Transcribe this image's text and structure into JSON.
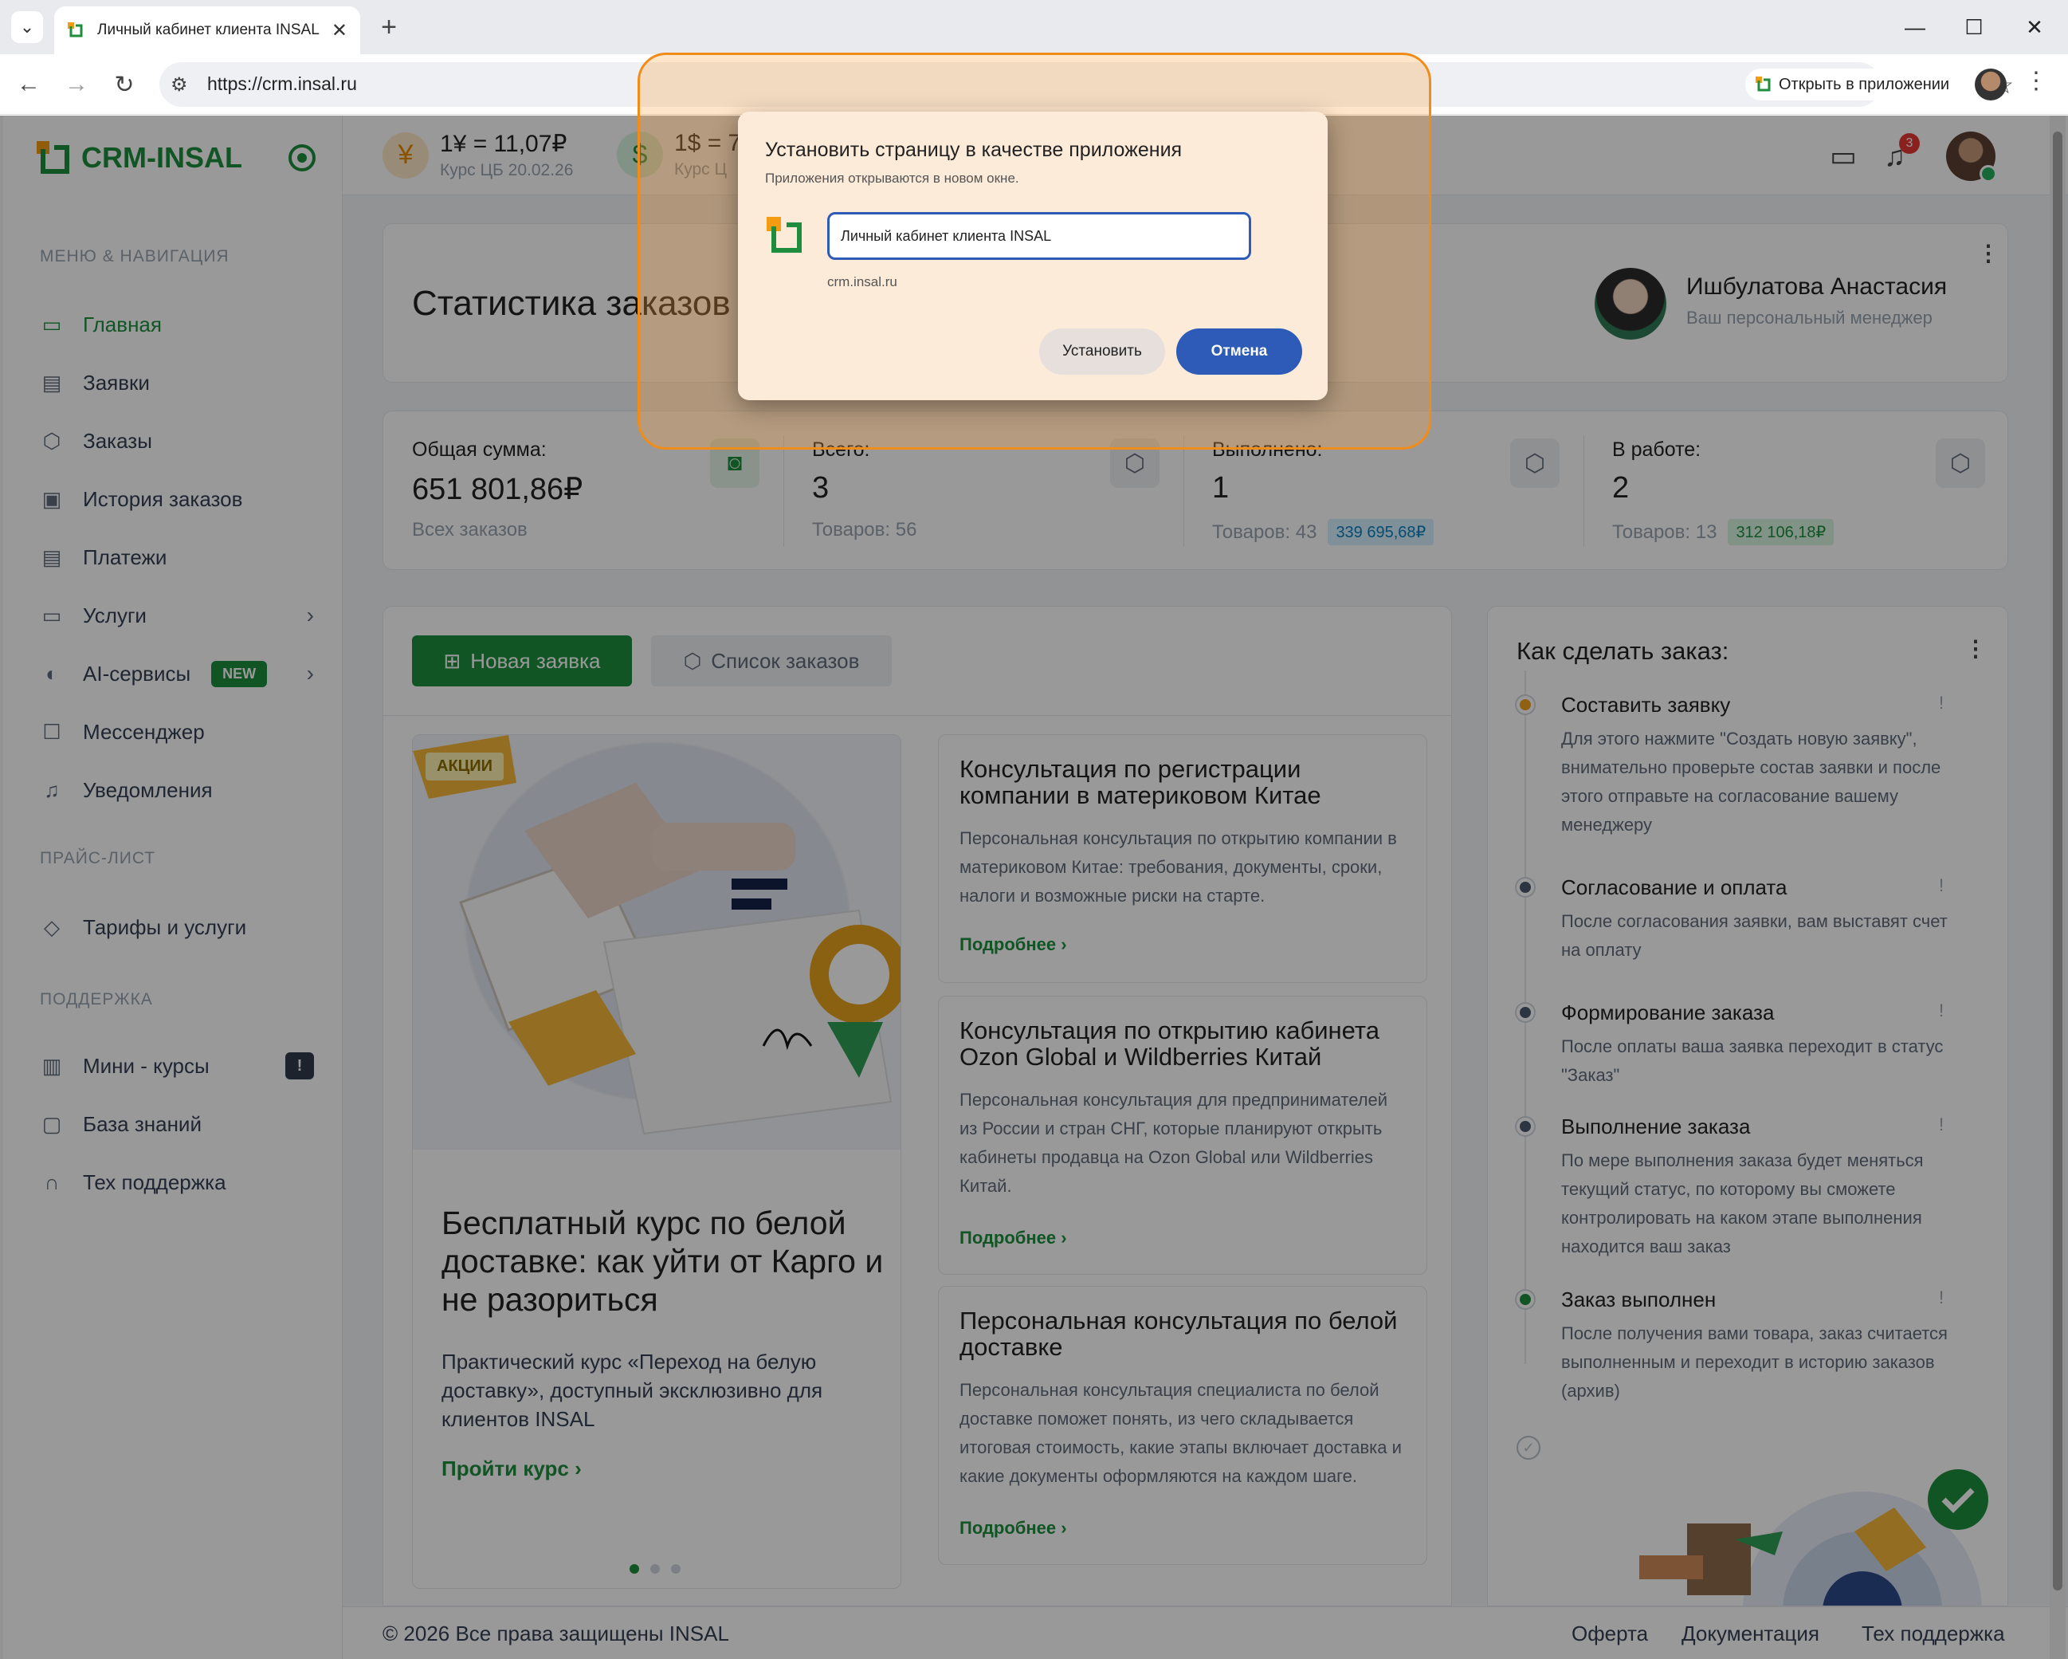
{
  "browser": {
    "tab_title": "Личный кабинет клиента INSAL",
    "url": "https://crm.insal.ru",
    "open_in_app": "Открыть в приложении"
  },
  "sidebar": {
    "logo": "CRM-INSAL",
    "section_menu": "МЕНЮ & НАВИГАЦИЯ",
    "items": [
      {
        "label": "Главная",
        "icon": "monitor-icon"
      },
      {
        "label": "Заявки",
        "icon": "document-icon"
      },
      {
        "label": "Заказы",
        "icon": "box-icon"
      },
      {
        "label": "История заказов",
        "icon": "archive-icon"
      },
      {
        "label": "Платежи",
        "icon": "receipt-icon"
      },
      {
        "label": "Услуги",
        "icon": "card-icon"
      },
      {
        "label": "AI-сервисы",
        "icon": "brain-icon",
        "badge": "NEW"
      },
      {
        "label": "Мессенджер",
        "icon": "chat-icon"
      },
      {
        "label": "Уведомления",
        "icon": "bell-icon"
      }
    ],
    "section_price": "ПРАЙС-ЛИСТ",
    "price_items": [
      {
        "label": "Тарифы и услуги",
        "icon": "tag-icon"
      }
    ],
    "section_support": "ПОДДЕРЖКА",
    "support_items": [
      {
        "label": "Мини - курсы",
        "icon": "book-icon",
        "badge": "!"
      },
      {
        "label": "База знаний",
        "icon": "knowledge-icon"
      },
      {
        "label": "Тех поддержка",
        "icon": "headset-icon"
      }
    ]
  },
  "topbar": {
    "rate1_value": "1¥ = 11,07₽",
    "rate1_sub": "Курс ЦБ 20.02.26",
    "rate2_value": "1$ = 7",
    "rate2_sub": "Курс Ц",
    "notifications_count": "3"
  },
  "header": {
    "title": "Статистика заказов",
    "manager_name": "Ишбулатова Анастасия",
    "manager_role": "Ваш персональный менеджер"
  },
  "stats": [
    {
      "label": "Общая сумма:",
      "value": "651 801,86₽",
      "sub": "Всех заказов"
    },
    {
      "label": "Всего:",
      "value": "3",
      "sub": "Товаров: 56"
    },
    {
      "label": "Выполнено:",
      "value": "1",
      "sub": "Товаров: 43",
      "amount": "339 695,68₽"
    },
    {
      "label": "В работе:",
      "value": "2",
      "sub": "Товаров: 13",
      "amount": "312 106,18₽"
    }
  ],
  "actions": {
    "new_request": "Новая заявка",
    "orders_list": "Список заказов"
  },
  "promo": {
    "badge": "АКЦИИ",
    "title": "Бесплатный курс по белой доставке: как уйти от Карго и не разориться",
    "desc": "Практический курс «Переход на белую доставку», доступный эксклюзивно для клиентов INSAL",
    "link": "Пройти курс"
  },
  "articles": [
    {
      "title": "Консультация по регистрации компании в материковом Китае",
      "desc": "Персональная консультация по открытию компании в материковом Китае: требования, документы, сроки, налоги и возможные риски на старте.",
      "link": "Подробнее"
    },
    {
      "title": "Консультация по открытию кабинета Ozon Global и Wildberries Китай",
      "desc": "Персональная консультация для предпринимателей из России и стран СНГ, которые планируют открыть кабинеты продавца на Ozon Global или Wildberries Китай.",
      "link": "Подробнее"
    },
    {
      "title": "Персональная консультация по белой доставке",
      "desc": "Персональная консультация специалиста по белой доставке поможет понять, из чего складывается итоговая стоимость, какие этапы включает доставка и какие документы оформляются на каждом шаге.",
      "link": "Подробнее"
    }
  ],
  "how": {
    "title": "Как сделать заказ:",
    "steps": [
      {
        "name": "Составить заявку",
        "desc": "Для этого нажмите \"Создать новую заявку\", внимательно проверьте состав заявки и после этого отправьте на согласование вашему менеджеру",
        "color": "#f0a020"
      },
      {
        "name": "Согласование и оплата",
        "desc": "После согласования заявки, вам выставят счет на оплату",
        "color": "#4a5a70"
      },
      {
        "name": "Формирование заказа",
        "desc": "После оплаты ваша заявка переходит в статус \"Заказ\"",
        "color": "#4a5a70"
      },
      {
        "name": "Выполнение заказа",
        "desc": "По мере выполнения заказа будет меняться текущий статус, по которому вы сможете контролировать на каком этапе выполнения находится ваш заказ",
        "color": "#4a5a70"
      },
      {
        "name": "Заказ выполнен",
        "desc": "После получения вами товара, заказ считается выполненным и переходит в историю заказов (архив)",
        "color": "#1e8e3e"
      }
    ]
  },
  "footer": {
    "copyright": "© 2026 Все права защищены INSAL",
    "links": [
      "Оферта",
      "Документация",
      "Тех поддержка"
    ]
  },
  "dialog": {
    "title": "Установить страницу в качестве приложения",
    "subtitle": "Приложения открываются в новом окне.",
    "input_value": "Личный кабинет клиента INSAL",
    "domain": "crm.insal.ru",
    "install": "Установить",
    "cancel": "Отмена"
  }
}
